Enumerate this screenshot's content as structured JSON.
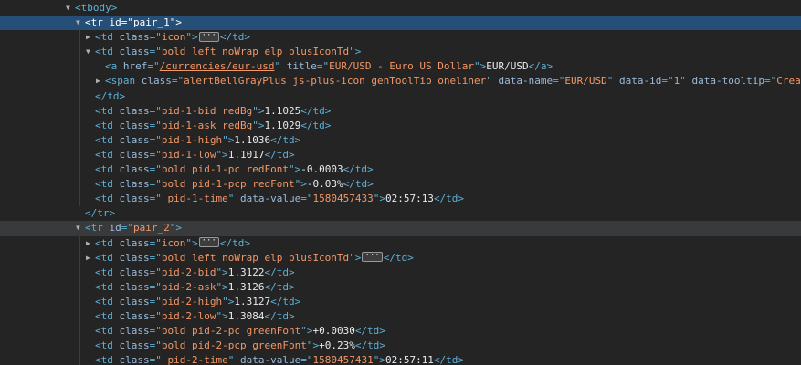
{
  "lines": [
    {
      "depth": 0,
      "toggle": "open",
      "state": "",
      "segments": [
        {
          "c": "tag",
          "t": "<tbody>"
        }
      ]
    },
    {
      "depth": 1,
      "toggle": "open",
      "state": "selected",
      "segments": [
        {
          "c": "tag",
          "t": "<tr "
        },
        {
          "c": "attr",
          "t": "id"
        },
        {
          "c": "tag",
          "t": "=\""
        },
        {
          "c": "val",
          "t": "pair_1"
        },
        {
          "c": "tag",
          "t": "\">"
        }
      ]
    },
    {
      "depth": 2,
      "toggle": "closed",
      "state": "",
      "segments": [
        {
          "c": "tag",
          "t": "<td "
        },
        {
          "c": "attr",
          "t": "class"
        },
        {
          "c": "tag",
          "t": "=\""
        },
        {
          "c": "val",
          "t": "icon"
        },
        {
          "c": "tag",
          "t": "\">"
        },
        {
          "c": "ellipsis",
          "t": "···"
        },
        {
          "c": "tag",
          "t": "</td>"
        }
      ]
    },
    {
      "depth": 2,
      "toggle": "open",
      "state": "",
      "segments": [
        {
          "c": "tag",
          "t": "<td "
        },
        {
          "c": "attr",
          "t": "class"
        },
        {
          "c": "tag",
          "t": "=\""
        },
        {
          "c": "val",
          "t": "bold left noWrap elp plusIconTd"
        },
        {
          "c": "tag",
          "t": "\">"
        }
      ]
    },
    {
      "depth": 3,
      "toggle": "none",
      "state": "",
      "segments": [
        {
          "c": "tag",
          "t": "<a "
        },
        {
          "c": "attr",
          "t": "href"
        },
        {
          "c": "tag",
          "t": "=\""
        },
        {
          "c": "link",
          "t": "/currencies/eur-usd"
        },
        {
          "c": "tag",
          "t": "\" "
        },
        {
          "c": "attr",
          "t": "title"
        },
        {
          "c": "tag",
          "t": "=\""
        },
        {
          "c": "val",
          "t": "EUR/USD - Euro US Dollar"
        },
        {
          "c": "tag",
          "t": "\">"
        },
        {
          "c": "txt",
          "t": "EUR/USD"
        },
        {
          "c": "tag",
          "t": "</a>"
        }
      ]
    },
    {
      "depth": 3,
      "toggle": "closed",
      "state": "",
      "segments": [
        {
          "c": "tag",
          "t": "<span "
        },
        {
          "c": "attr",
          "t": "class"
        },
        {
          "c": "tag",
          "t": "=\""
        },
        {
          "c": "val",
          "t": "alertBellGrayPlus js-plus-icon genToolTip oneliner"
        },
        {
          "c": "tag",
          "t": "\" "
        },
        {
          "c": "attr",
          "t": "data-name"
        },
        {
          "c": "tag",
          "t": "=\""
        },
        {
          "c": "val",
          "t": "EUR/USD"
        },
        {
          "c": "tag",
          "t": "\" "
        },
        {
          "c": "attr",
          "t": "data-id"
        },
        {
          "c": "tag",
          "t": "=\""
        },
        {
          "c": "val",
          "t": "1"
        },
        {
          "c": "tag",
          "t": "\" "
        },
        {
          "c": "attr",
          "t": "data-tooltip"
        },
        {
          "c": "tag",
          "t": "=\""
        },
        {
          "c": "val",
          "t": "Crea"
        }
      ]
    },
    {
      "depth": 2,
      "toggle": "none",
      "state": "",
      "segments": [
        {
          "c": "tag",
          "t": "</td>"
        }
      ]
    },
    {
      "depth": 2,
      "toggle": "none",
      "state": "",
      "segments": [
        {
          "c": "tag",
          "t": "<td "
        },
        {
          "c": "attr",
          "t": "class"
        },
        {
          "c": "tag",
          "t": "=\""
        },
        {
          "c": "val",
          "t": "pid-1-bid redBg"
        },
        {
          "c": "tag",
          "t": "\">"
        },
        {
          "c": "txt",
          "t": "1.1025"
        },
        {
          "c": "tag",
          "t": "</td>"
        }
      ]
    },
    {
      "depth": 2,
      "toggle": "none",
      "state": "",
      "segments": [
        {
          "c": "tag",
          "t": "<td "
        },
        {
          "c": "attr",
          "t": "class"
        },
        {
          "c": "tag",
          "t": "=\""
        },
        {
          "c": "val",
          "t": "pid-1-ask redBg"
        },
        {
          "c": "tag",
          "t": "\">"
        },
        {
          "c": "txt",
          "t": "1.1029"
        },
        {
          "c": "tag",
          "t": "</td>"
        }
      ]
    },
    {
      "depth": 2,
      "toggle": "none",
      "state": "",
      "segments": [
        {
          "c": "tag",
          "t": "<td "
        },
        {
          "c": "attr",
          "t": "class"
        },
        {
          "c": "tag",
          "t": "=\""
        },
        {
          "c": "val",
          "t": "pid-1-high"
        },
        {
          "c": "tag",
          "t": "\">"
        },
        {
          "c": "txt",
          "t": "1.1036"
        },
        {
          "c": "tag",
          "t": "</td>"
        }
      ]
    },
    {
      "depth": 2,
      "toggle": "none",
      "state": "",
      "segments": [
        {
          "c": "tag",
          "t": "<td "
        },
        {
          "c": "attr",
          "t": "class"
        },
        {
          "c": "tag",
          "t": "=\""
        },
        {
          "c": "val",
          "t": "pid-1-low"
        },
        {
          "c": "tag",
          "t": "\">"
        },
        {
          "c": "txt",
          "t": "1.1017"
        },
        {
          "c": "tag",
          "t": "</td>"
        }
      ]
    },
    {
      "depth": 2,
      "toggle": "none",
      "state": "",
      "segments": [
        {
          "c": "tag",
          "t": "<td "
        },
        {
          "c": "attr",
          "t": "class"
        },
        {
          "c": "tag",
          "t": "=\""
        },
        {
          "c": "val",
          "t": "bold pid-1-pc redFont"
        },
        {
          "c": "tag",
          "t": "\">"
        },
        {
          "c": "txt",
          "t": "-0.0003"
        },
        {
          "c": "tag",
          "t": "</td>"
        }
      ]
    },
    {
      "depth": 2,
      "toggle": "none",
      "state": "",
      "segments": [
        {
          "c": "tag",
          "t": "<td "
        },
        {
          "c": "attr",
          "t": "class"
        },
        {
          "c": "tag",
          "t": "=\""
        },
        {
          "c": "val",
          "t": "bold pid-1-pcp redFont"
        },
        {
          "c": "tag",
          "t": "\">"
        },
        {
          "c": "txt",
          "t": "-0.03%"
        },
        {
          "c": "tag",
          "t": "</td>"
        }
      ]
    },
    {
      "depth": 2,
      "toggle": "none",
      "state": "",
      "segments": [
        {
          "c": "tag",
          "t": "<td "
        },
        {
          "c": "attr",
          "t": "class"
        },
        {
          "c": "tag",
          "t": "=\""
        },
        {
          "c": "val",
          "t": " pid-1-time"
        },
        {
          "c": "tag",
          "t": "\" "
        },
        {
          "c": "attr",
          "t": "data-value"
        },
        {
          "c": "tag",
          "t": "=\""
        },
        {
          "c": "val",
          "t": "1580457433"
        },
        {
          "c": "tag",
          "t": "\">"
        },
        {
          "c": "txt",
          "t": "02:57:13"
        },
        {
          "c": "tag",
          "t": "</td>"
        }
      ]
    },
    {
      "depth": 1,
      "toggle": "none",
      "state": "",
      "segments": [
        {
          "c": "tag",
          "t": "</tr>"
        }
      ]
    },
    {
      "depth": 1,
      "toggle": "open",
      "state": "hover",
      "segments": [
        {
          "c": "tag",
          "t": "<tr "
        },
        {
          "c": "attr",
          "t": "id"
        },
        {
          "c": "tag",
          "t": "=\""
        },
        {
          "c": "val",
          "t": "pair_2"
        },
        {
          "c": "tag",
          "t": "\">"
        }
      ]
    },
    {
      "depth": 2,
      "toggle": "closed",
      "state": "",
      "segments": [
        {
          "c": "tag",
          "t": "<td "
        },
        {
          "c": "attr",
          "t": "class"
        },
        {
          "c": "tag",
          "t": "=\""
        },
        {
          "c": "val",
          "t": "icon"
        },
        {
          "c": "tag",
          "t": "\">"
        },
        {
          "c": "ellipsis",
          "t": "···"
        },
        {
          "c": "tag",
          "t": "</td>"
        }
      ]
    },
    {
      "depth": 2,
      "toggle": "closed",
      "state": "",
      "segments": [
        {
          "c": "tag",
          "t": "<td "
        },
        {
          "c": "attr",
          "t": "class"
        },
        {
          "c": "tag",
          "t": "=\""
        },
        {
          "c": "val",
          "t": "bold left noWrap elp plusIconTd"
        },
        {
          "c": "tag",
          "t": "\">"
        },
        {
          "c": "ellipsis",
          "t": "···"
        },
        {
          "c": "tag",
          "t": "</td>"
        }
      ]
    },
    {
      "depth": 2,
      "toggle": "none",
      "state": "",
      "segments": [
        {
          "c": "tag",
          "t": "<td "
        },
        {
          "c": "attr",
          "t": "class"
        },
        {
          "c": "tag",
          "t": "=\""
        },
        {
          "c": "val",
          "t": "pid-2-bid"
        },
        {
          "c": "tag",
          "t": "\">"
        },
        {
          "c": "txt",
          "t": "1.3122"
        },
        {
          "c": "tag",
          "t": "</td>"
        }
      ]
    },
    {
      "depth": 2,
      "toggle": "none",
      "state": "",
      "segments": [
        {
          "c": "tag",
          "t": "<td "
        },
        {
          "c": "attr",
          "t": "class"
        },
        {
          "c": "tag",
          "t": "=\""
        },
        {
          "c": "val",
          "t": "pid-2-ask"
        },
        {
          "c": "tag",
          "t": "\">"
        },
        {
          "c": "txt",
          "t": "1.3126"
        },
        {
          "c": "tag",
          "t": "</td>"
        }
      ]
    },
    {
      "depth": 2,
      "toggle": "none",
      "state": "",
      "segments": [
        {
          "c": "tag",
          "t": "<td "
        },
        {
          "c": "attr",
          "t": "class"
        },
        {
          "c": "tag",
          "t": "=\""
        },
        {
          "c": "val",
          "t": "pid-2-high"
        },
        {
          "c": "tag",
          "t": "\">"
        },
        {
          "c": "txt",
          "t": "1.3127"
        },
        {
          "c": "tag",
          "t": "</td>"
        }
      ]
    },
    {
      "depth": 2,
      "toggle": "none",
      "state": "",
      "segments": [
        {
          "c": "tag",
          "t": "<td "
        },
        {
          "c": "attr",
          "t": "class"
        },
        {
          "c": "tag",
          "t": "=\""
        },
        {
          "c": "val",
          "t": "pid-2-low"
        },
        {
          "c": "tag",
          "t": "\">"
        },
        {
          "c": "txt",
          "t": "1.3084"
        },
        {
          "c": "tag",
          "t": "</td>"
        }
      ]
    },
    {
      "depth": 2,
      "toggle": "none",
      "state": "",
      "segments": [
        {
          "c": "tag",
          "t": "<td "
        },
        {
          "c": "attr",
          "t": "class"
        },
        {
          "c": "tag",
          "t": "=\""
        },
        {
          "c": "val",
          "t": "bold pid-2-pc greenFont"
        },
        {
          "c": "tag",
          "t": "\">"
        },
        {
          "c": "txt",
          "t": "+0.0030"
        },
        {
          "c": "tag",
          "t": "</td>"
        }
      ]
    },
    {
      "depth": 2,
      "toggle": "none",
      "state": "",
      "segments": [
        {
          "c": "tag",
          "t": "<td "
        },
        {
          "c": "attr",
          "t": "class"
        },
        {
          "c": "tag",
          "t": "=\""
        },
        {
          "c": "val",
          "t": "bold pid-2-pcp greenFont"
        },
        {
          "c": "tag",
          "t": "\">"
        },
        {
          "c": "txt",
          "t": "+0.23%"
        },
        {
          "c": "tag",
          "t": "</td>"
        }
      ]
    },
    {
      "depth": 2,
      "toggle": "none",
      "state": "",
      "segments": [
        {
          "c": "tag",
          "t": "<td "
        },
        {
          "c": "attr",
          "t": "class"
        },
        {
          "c": "tag",
          "t": "=\""
        },
        {
          "c": "val",
          "t": " pid-2-time"
        },
        {
          "c": "tag",
          "t": "\" "
        },
        {
          "c": "attr",
          "t": "data-value"
        },
        {
          "c": "tag",
          "t": "=\""
        },
        {
          "c": "val",
          "t": "1580457431"
        },
        {
          "c": "tag",
          "t": "\">"
        },
        {
          "c": "txt",
          "t": "02:57:11"
        },
        {
          "c": "tag",
          "t": "</td>"
        }
      ]
    }
  ]
}
